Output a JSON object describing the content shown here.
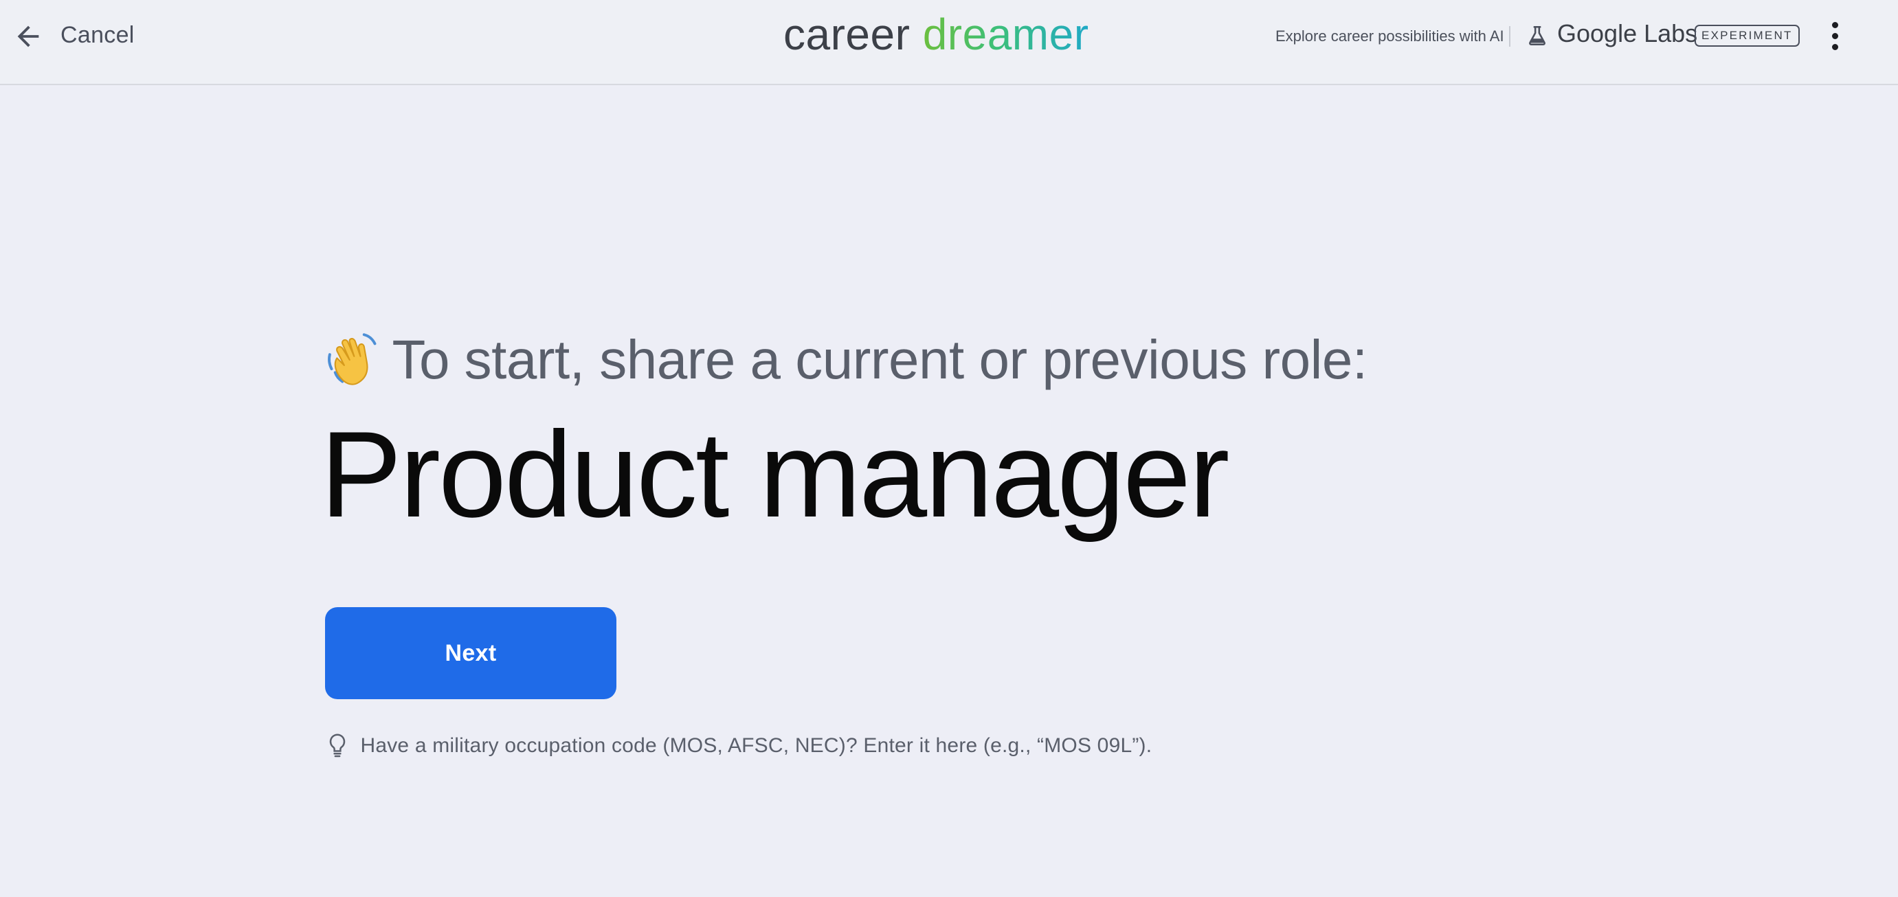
{
  "header": {
    "cancel_label": "Cancel",
    "brand_word1": "career",
    "brand_word2": "dreamer",
    "tagline": "Explore career possibilities with AI",
    "labs_name": "Google Labs",
    "experiment_badge": "EXPERIMENT",
    "icons": {
      "back": "arrow-left-icon",
      "labs": "flask-icon",
      "menu": "more-vert-icon"
    }
  },
  "main": {
    "prompt_emoji": "waving-hand-icon",
    "prompt": "To start, share a current or previous role:",
    "role_value": "Product manager",
    "next_label": "Next",
    "hint_icon": "lightbulb-icon",
    "hint": "Have a military occupation code (MOS, AFSC, NEC)? Enter it here (e.g., “MOS 09L”)."
  },
  "colors": {
    "background": "#edeef6",
    "primary_button": "#1f6be8",
    "brand_gradient_start": "#6cbf3f",
    "brand_gradient_end": "#1fa9c7",
    "muted_text": "#5a5f6b"
  }
}
